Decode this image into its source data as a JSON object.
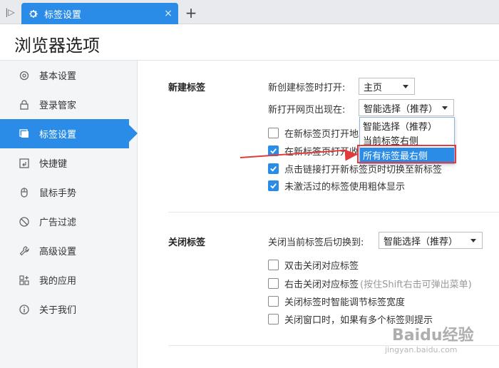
{
  "tab": {
    "title": "标签设置",
    "close": "×",
    "new": "+",
    "toggle": "|▷"
  },
  "page": {
    "title": "浏览器选项"
  },
  "sidebar": {
    "items": [
      {
        "label": "基本设置",
        "icon": "gear-icon"
      },
      {
        "label": "登录管家",
        "icon": "lock-icon"
      },
      {
        "label": "标签设置",
        "icon": "tabs-icon",
        "active": true
      },
      {
        "label": "快捷键",
        "icon": "keyboard-icon"
      },
      {
        "label": "鼠标手势",
        "icon": "mouse-icon"
      },
      {
        "label": "广告过滤",
        "icon": "block-icon"
      },
      {
        "label": "高级设置",
        "icon": "wrench-icon"
      },
      {
        "label": "我的应用",
        "icon": "apps-icon"
      },
      {
        "label": "关于我们",
        "icon": "info-icon"
      }
    ]
  },
  "new_tab": {
    "section": "新建标签",
    "open_label": "新创建标签时打开:",
    "open_value": "主页",
    "position_label": "新打开网页出现在:",
    "position_value": "智能选择（推荐）",
    "dropdown_options": [
      "智能选择（推荐）",
      "当前标签右侧",
      "所有标签最右侧"
    ],
    "checks": [
      {
        "label": "在新标签页打开地",
        "checked": false
      },
      {
        "label": "在新标签页打开收",
        "checked": true
      },
      {
        "label": "点击链接打开新标签页时切换至新标签",
        "checked": true
      },
      {
        "label": "未激活过的标签使用粗体显示",
        "checked": true
      }
    ]
  },
  "close_tab": {
    "section": "关闭标签",
    "switch_label": "关闭当前标签后切换到:",
    "switch_value": "智能选择（推荐）",
    "checks": [
      {
        "label": "双击关闭对应标签",
        "checked": false
      },
      {
        "label": "右击关闭对应标签",
        "hint": "(按住Shift右击可弹出菜单)",
        "checked": false
      },
      {
        "label": "关闭标签时智能调节标签宽度",
        "checked": false
      },
      {
        "label": "关闭窗口时，如果有多个标签则提示",
        "checked": false
      }
    ]
  },
  "watermark": {
    "text": "Baidu经验",
    "sub": "jingyan.baidu.com"
  },
  "colors": {
    "accent": "#2b8ce8",
    "annotation": "#e23b3b"
  }
}
